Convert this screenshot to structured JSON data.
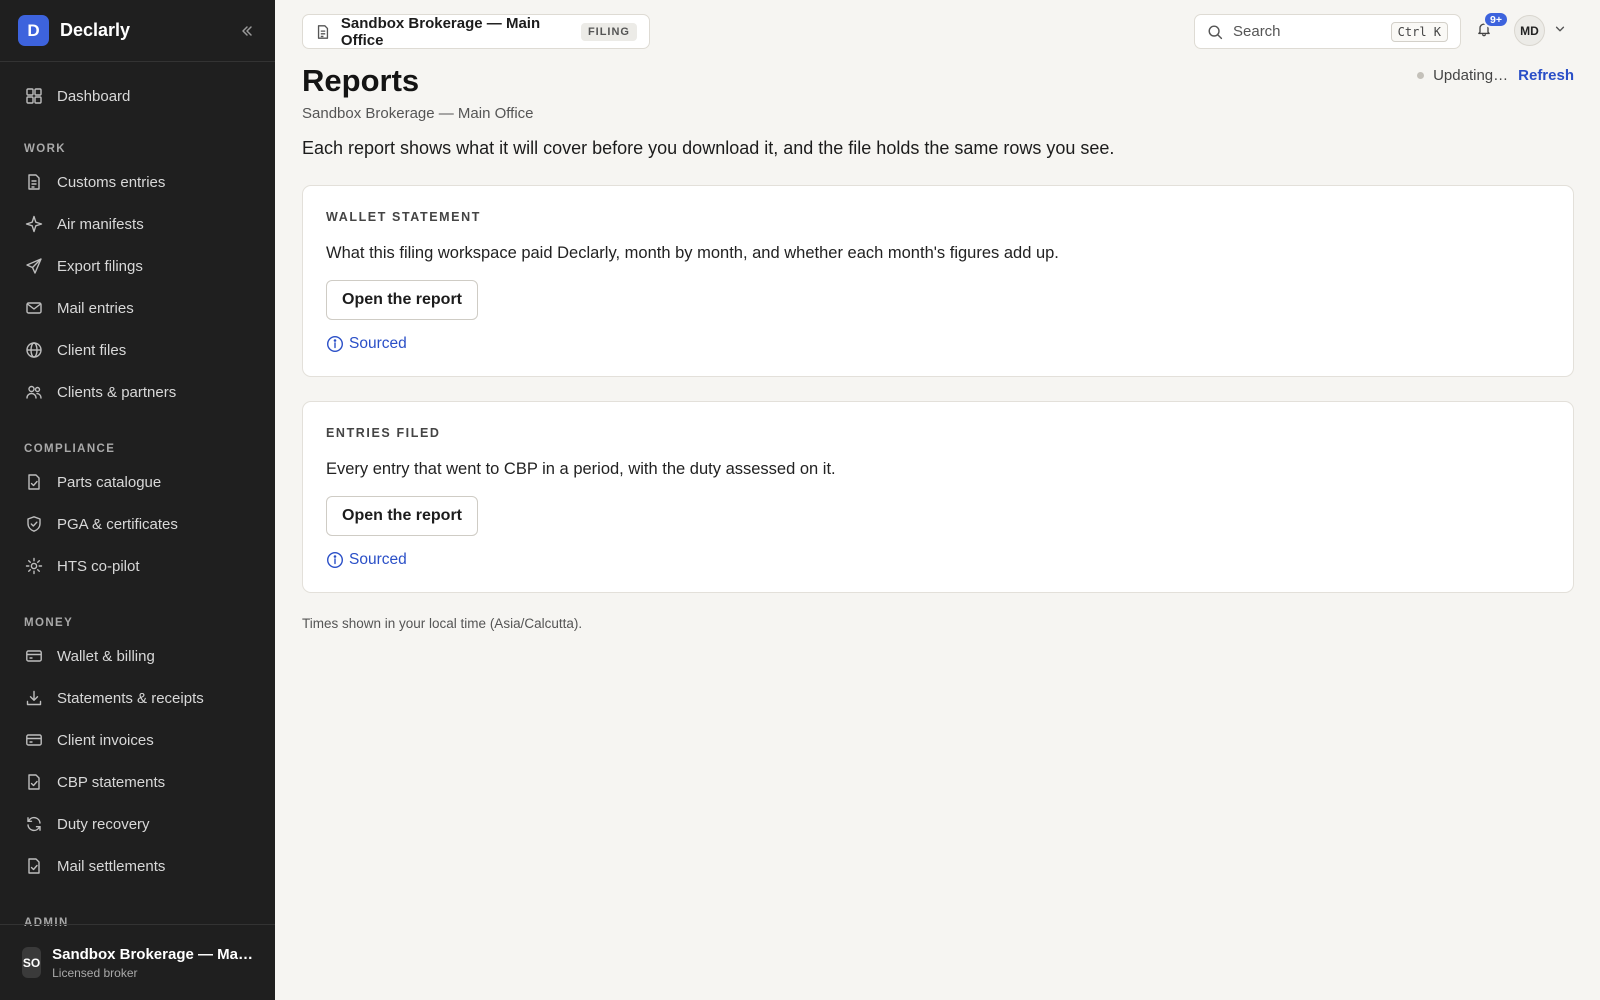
{
  "app": {
    "logo_letter": "D",
    "name": "Declarly"
  },
  "sidebar": {
    "top_items": [
      {
        "label": "Dashboard",
        "icon": "grid-icon"
      }
    ],
    "sections": [
      {
        "title": "WORK",
        "items": [
          {
            "label": "Customs entries",
            "icon": "document-icon"
          },
          {
            "label": "Air manifests",
            "icon": "sparkle-icon"
          },
          {
            "label": "Export filings",
            "icon": "send-icon"
          },
          {
            "label": "Mail entries",
            "icon": "mail-icon"
          },
          {
            "label": "Client files",
            "icon": "globe-icon"
          },
          {
            "label": "Clients & partners",
            "icon": "users-icon"
          }
        ]
      },
      {
        "title": "COMPLIANCE",
        "items": [
          {
            "label": "Parts catalogue",
            "icon": "file-check-icon"
          },
          {
            "label": "PGA & certificates",
            "icon": "shield-check-icon"
          },
          {
            "label": "HTS co-pilot",
            "icon": "sun-icon"
          }
        ]
      },
      {
        "title": "MONEY",
        "items": [
          {
            "label": "Wallet & billing",
            "icon": "card-icon"
          },
          {
            "label": "Statements & receipts",
            "icon": "download-icon"
          },
          {
            "label": "Client invoices",
            "icon": "card-icon"
          },
          {
            "label": "CBP statements",
            "icon": "file-check-icon"
          },
          {
            "label": "Duty recovery",
            "icon": "refresh-icon"
          },
          {
            "label": "Mail settlements",
            "icon": "file-check-icon"
          }
        ]
      },
      {
        "title": "ADMIN",
        "items": []
      }
    ],
    "footer": {
      "avatar": "SO",
      "org_name": "Sandbox Brokerage — Ma…",
      "role": "Licensed broker"
    }
  },
  "topbar": {
    "workspace_name": "Sandbox Brokerage — Main Office",
    "workspace_badge": "FILING",
    "search_placeholder": "Search",
    "search_shortcut": "Ctrl K",
    "notifications_badge": "9+",
    "user_initials": "MD"
  },
  "page": {
    "title": "Reports",
    "subtitle": "Sandbox Brokerage — Main Office",
    "intro": "Each report shows what it will cover before you download it, and the file holds the same rows you see.",
    "status_text": "Updating…",
    "refresh_label": "Refresh",
    "timezone_note": "Times shown in your local time (Asia/Calcutta)."
  },
  "reports": [
    {
      "eyebrow": "WALLET STATEMENT",
      "description": "What this filing workspace paid Declarly, month by month, and whether each month's figures add up.",
      "button_label": "Open the report",
      "sourced_label": "Sourced"
    },
    {
      "eyebrow": "ENTRIES FILED",
      "description": "Every entry that went to CBP in a period, with the duty assessed on it.",
      "button_label": "Open the report",
      "sourced_label": "Sourced"
    }
  ]
}
